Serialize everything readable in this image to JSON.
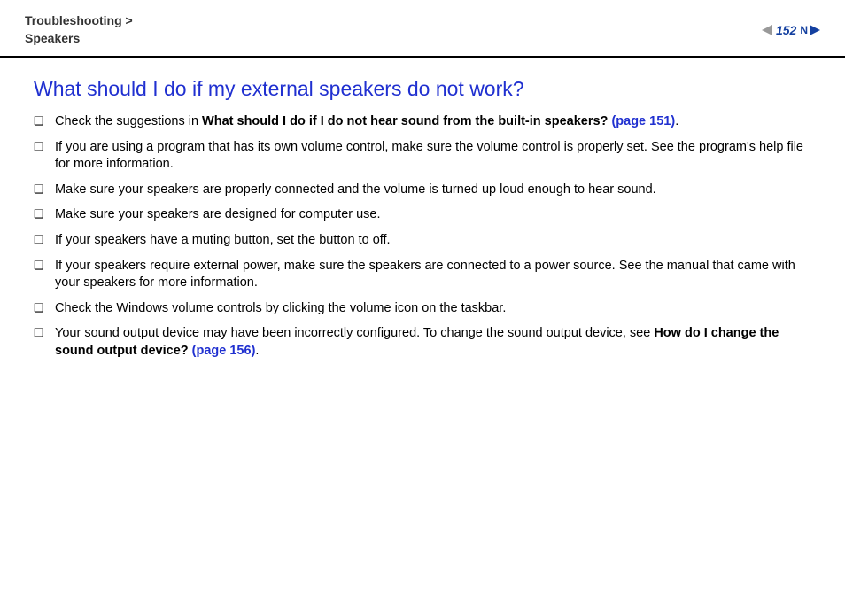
{
  "header": {
    "breadcrumb_line1": "Troubleshooting >",
    "breadcrumb_line2": "Speakers",
    "page_number": "152",
    "n_label": "N"
  },
  "content": {
    "heading": "What should I do if my external speakers do not work?",
    "items": [
      {
        "prefix": "Check the suggestions in ",
        "bold1": "What should I do if I do not hear sound from the built-in speakers? ",
        "link1": "(page 151)",
        "suffix": "."
      },
      {
        "text": "If you are using a program that has its own volume control, make sure the volume control is properly set. See the program's help file for more information."
      },
      {
        "text": "Make sure your speakers are properly connected and the volume is turned up loud enough to hear sound."
      },
      {
        "text": "Make sure your speakers are designed for computer use."
      },
      {
        "text": "If your speakers have a muting button, set the button to off."
      },
      {
        "text": "If your speakers require external power, make sure the speakers are connected to a power source. See the manual that came with your speakers for more information."
      },
      {
        "text": "Check the Windows volume controls by clicking the volume icon on the taskbar."
      },
      {
        "prefix": "Your sound output device may have been incorrectly configured. To change the sound output device, see ",
        "bold1": "How do I change the sound output device? ",
        "link1": "(page 156)",
        "suffix": "."
      }
    ]
  }
}
